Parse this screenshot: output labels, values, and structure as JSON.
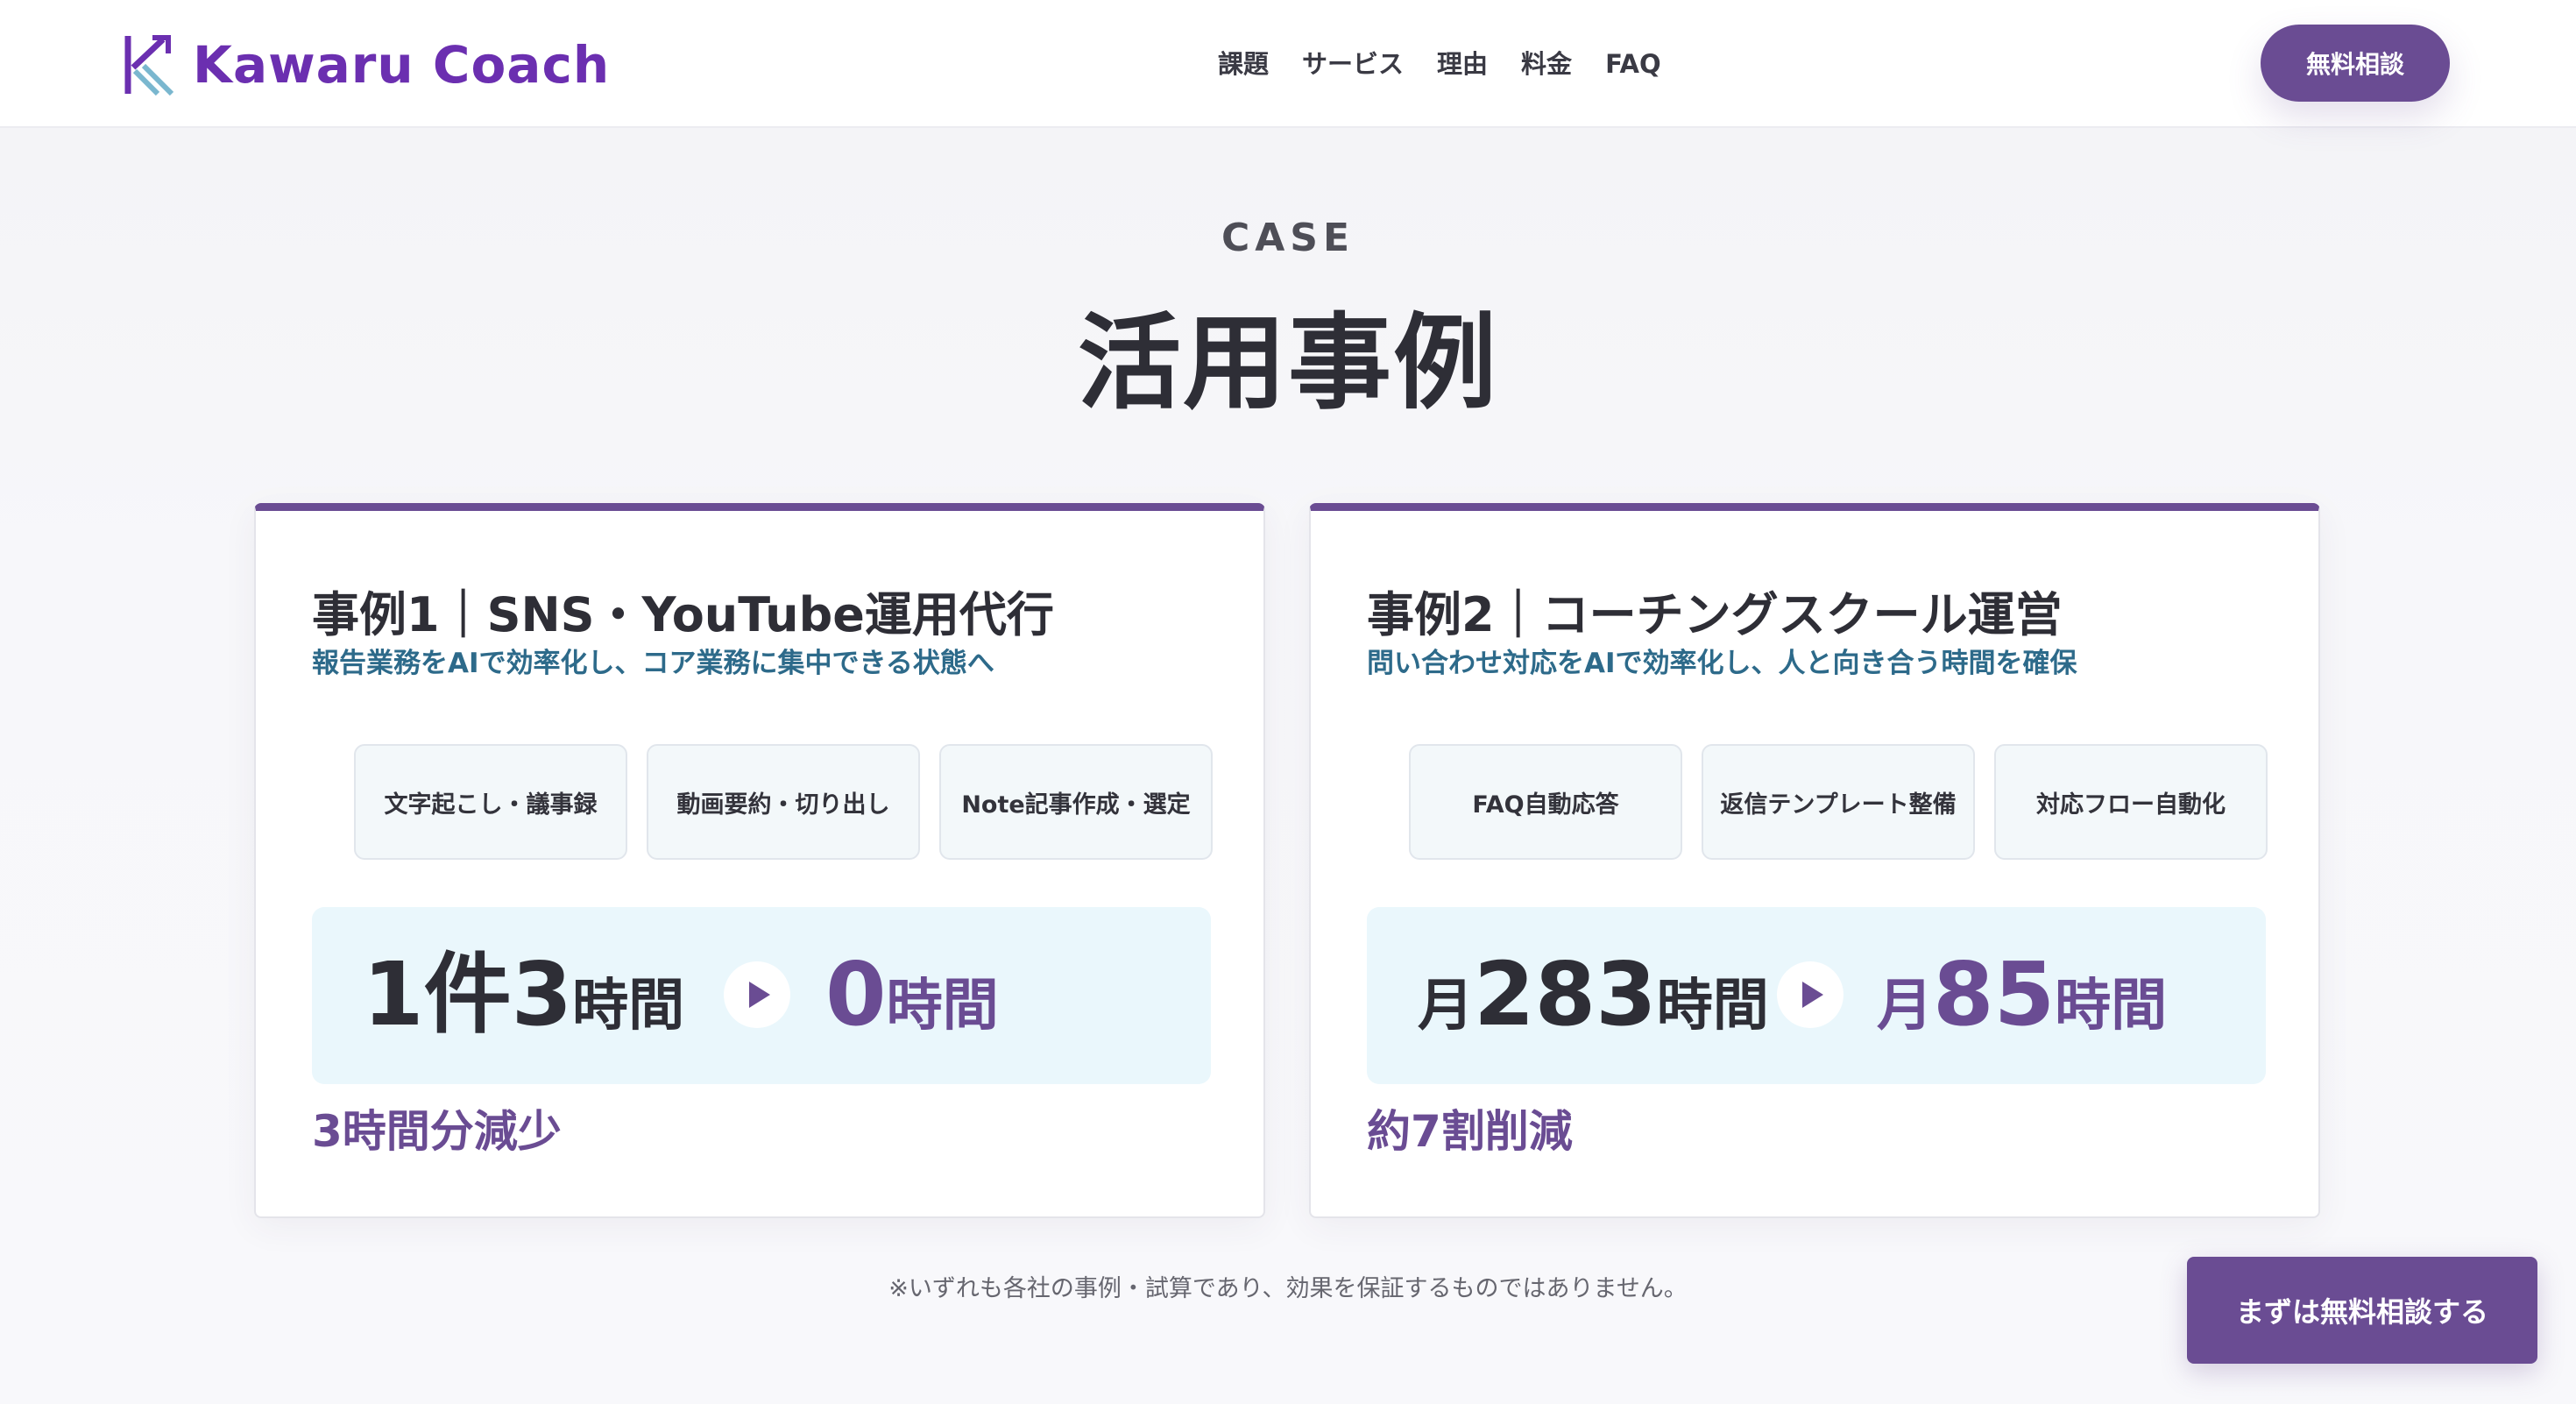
{
  "header": {
    "brand": "Kawaru Coach",
    "nav": [
      "課題",
      "サービス",
      "理由",
      "料金",
      "FAQ"
    ],
    "cta": "無料相談"
  },
  "section": {
    "eyebrow": "CASE",
    "title": "活用事例"
  },
  "cases": [
    {
      "heading": "事例1｜SNS・YouTube運用代行",
      "subtitle": "報告業務をAIで効率化し、コア業務に集中できる状態へ",
      "chips": [
        "文字起こし・議事録",
        "動画要約・切り出し",
        "Note記事作成・選定"
      ],
      "before_prefix": "",
      "before_num": "1件3",
      "before_unit": "時間",
      "after_prefix": "",
      "after_num": "0",
      "after_unit": "時間",
      "result": "3時間分減少"
    },
    {
      "heading": "事例2｜コーチングスクール運営",
      "subtitle": "問い合わせ対応をAIで効率化し、人と向き合う時間を確保",
      "chips": [
        "FAQ自動応答",
        "返信テンプレート整備",
        "対応フロー自動化"
      ],
      "before_prefix": "月",
      "before_num": "283",
      "before_unit": "時間",
      "after_prefix": "月",
      "after_num": "85",
      "after_unit": "時間",
      "result": "約7割削減"
    }
  ],
  "disclaimer": "※いずれも各社の事例・試算であり、効果を保証するものではありません。",
  "floating_cta": "まずは無料相談する",
  "colors": {
    "brand_purple": "#6a4c93",
    "logo_purple": "#6b2fb0",
    "subtitle_teal": "#2d6a8a",
    "metric_bg": "#eaf7fc"
  }
}
